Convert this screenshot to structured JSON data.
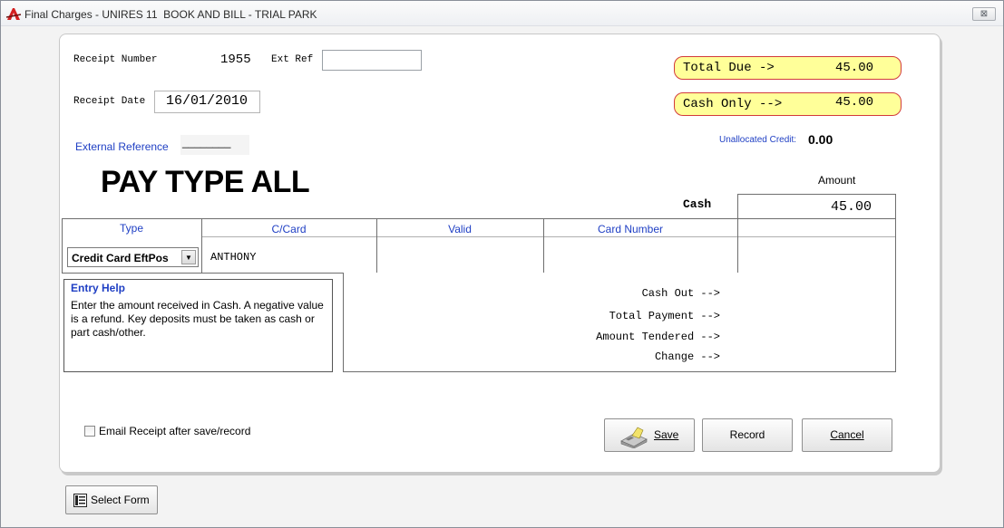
{
  "window": {
    "title": "Final Charges - UNIRES 11  BOOK AND BILL - TRIAL PARK",
    "close_glyph": "⊠"
  },
  "receipt": {
    "number_label": "Receipt Number",
    "number_value": "1955",
    "ext_ref_label": "Ext Ref",
    "ext_ref_value": "",
    "date_label": "Receipt Date",
    "date_value": "16/01/2010",
    "external_reference_label": "External Reference",
    "external_reference_value": "________"
  },
  "totals": {
    "total_due_label": "Total Due  ->",
    "total_due_value": "45.00",
    "cash_only_label": "Cash Only -->",
    "cash_only_value": "45.00",
    "unallocated_label": "Unallocated Credit:",
    "unallocated_value": "0.00"
  },
  "pay_type": {
    "heading": "PAY TYPE ALL",
    "amount_header": "Amount",
    "cash_label": "Cash",
    "cash_amount": "45.00"
  },
  "card_table": {
    "columns": [
      "Type",
      "C/Card",
      "Valid",
      "Card Number"
    ],
    "type_selected": "Credit Card EftPos",
    "ccard_value": "ANTHONY",
    "valid_value": "",
    "card_number_value": ""
  },
  "entry_help": {
    "title": "Entry Help",
    "text": "Enter the amount received in Cash. A negative value is a refund. Key deposits must be taken as cash or part cash/other."
  },
  "summary": {
    "cash_out_label": "Cash Out -->",
    "total_payment_label": "Total Payment -->",
    "amount_tendered_label": "Amount Tendered -->",
    "change_label": "Change -->",
    "cash_out_value": "",
    "total_payment_value": "",
    "amount_tendered_value": "",
    "change_value": ""
  },
  "options": {
    "email_receipt_label": "Email Receipt after save/record",
    "email_receipt_checked": false
  },
  "buttons": {
    "save": "Save",
    "record": "Record",
    "cancel": "Cancel",
    "select_form": "Select Form"
  },
  "colors": {
    "accent_blue": "#1f3fc4",
    "pill_fill": "#ffff99",
    "pill_border": "#d23b3b",
    "app_icon_red": "#d42020"
  },
  "icons": {
    "app": "app-logo-icon",
    "save": "cash-register-icon",
    "select_form": "form-list-icon",
    "dropdown": "chevron-down-icon"
  }
}
